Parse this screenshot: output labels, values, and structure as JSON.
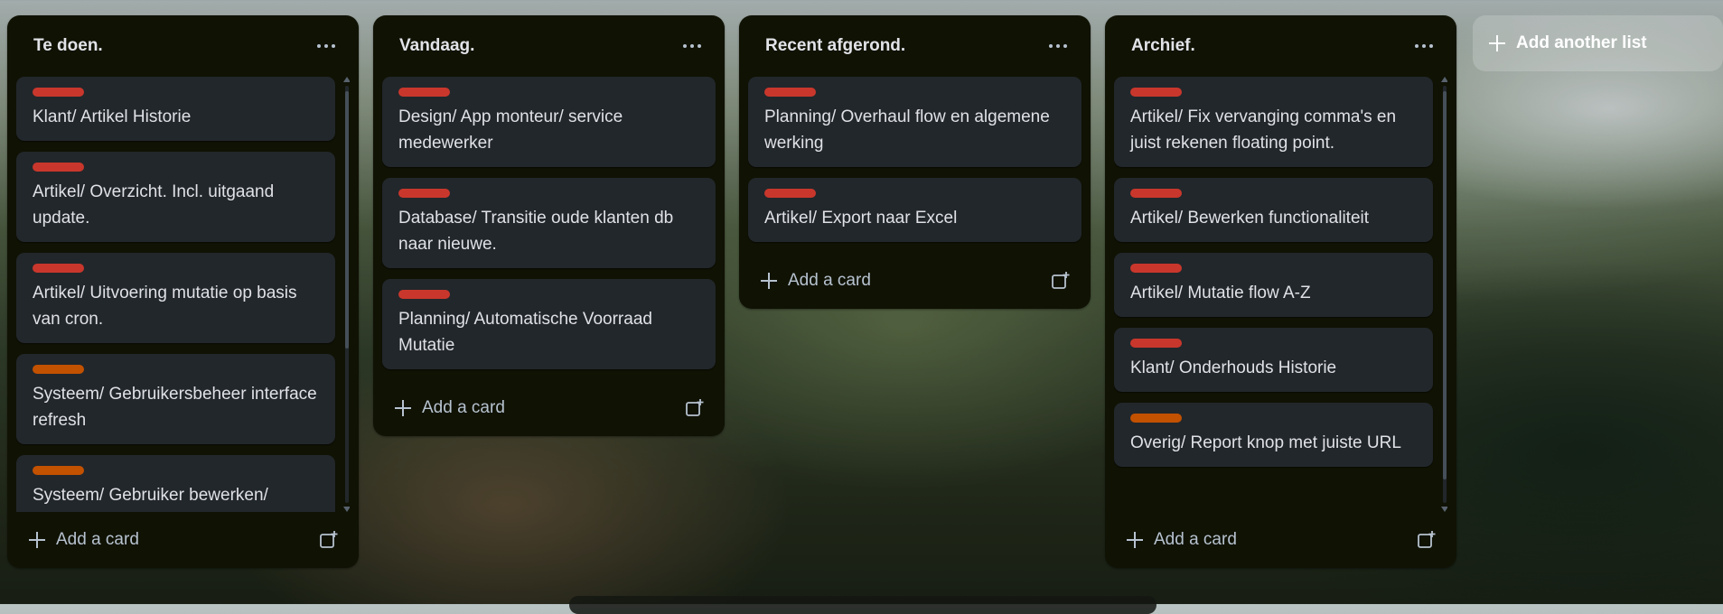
{
  "colors": {
    "red_label": "#c9372c",
    "orange_label": "#c25100"
  },
  "icons": {
    "menu": "ellipsis-icon",
    "add": "plus-icon",
    "template": "card-template-icon"
  },
  "lists": [
    {
      "title": "Te doen.",
      "add_card_label": "Add a card",
      "cards": [
        {
          "title": "Klant/ Artikel Historie",
          "label_color": "#c9372c"
        },
        {
          "title": "Artikel/ Overzicht. Incl. uitgaand update.",
          "label_color": "#c9372c"
        },
        {
          "title": "Artikel/ Uitvoering mutatie op basis van cron.",
          "label_color": "#c9372c"
        },
        {
          "title": "Systeem/ Gebruikersbeheer interface refresh",
          "label_color": "#c25100"
        },
        {
          "title": "Systeem/ Gebruiker bewerken/ gebruiker historie",
          "label_color": "#c25100"
        }
      ]
    },
    {
      "title": "Vandaag.",
      "add_card_label": "Add a card",
      "cards": [
        {
          "title": "Design/ App monteur/ service medewerker",
          "label_color": "#c9372c"
        },
        {
          "title": "Database/ Transitie oude klanten db naar nieuwe.",
          "label_color": "#c9372c"
        },
        {
          "title": "Planning/ Automatische Voorraad Mutatie",
          "label_color": "#c9372c"
        }
      ]
    },
    {
      "title": "Recent afgerond.",
      "add_card_label": "Add a card",
      "cards": [
        {
          "title": "Planning/ Overhaul flow en algemene werking",
          "label_color": "#c9372c"
        },
        {
          "title": "Artikel/ Export naar Excel",
          "label_color": "#c9372c"
        }
      ]
    },
    {
      "title": "Archief.",
      "add_card_label": "Add a card",
      "cards": [
        {
          "title": "Artikel/ Fix vervanging comma's en juist rekenen floating point.",
          "label_color": "#c9372c"
        },
        {
          "title": "Artikel/ Bewerken functionaliteit",
          "label_color": "#c9372c"
        },
        {
          "title": "Artikel/ Mutatie flow A-Z",
          "label_color": "#c9372c"
        },
        {
          "title": "Klant/ Onderhouds Historie",
          "label_color": "#c9372c"
        },
        {
          "title": "Overig/ Report knop met juiste URL",
          "label_color": "#c25100"
        }
      ]
    }
  ],
  "add_list_label": "Add another list"
}
